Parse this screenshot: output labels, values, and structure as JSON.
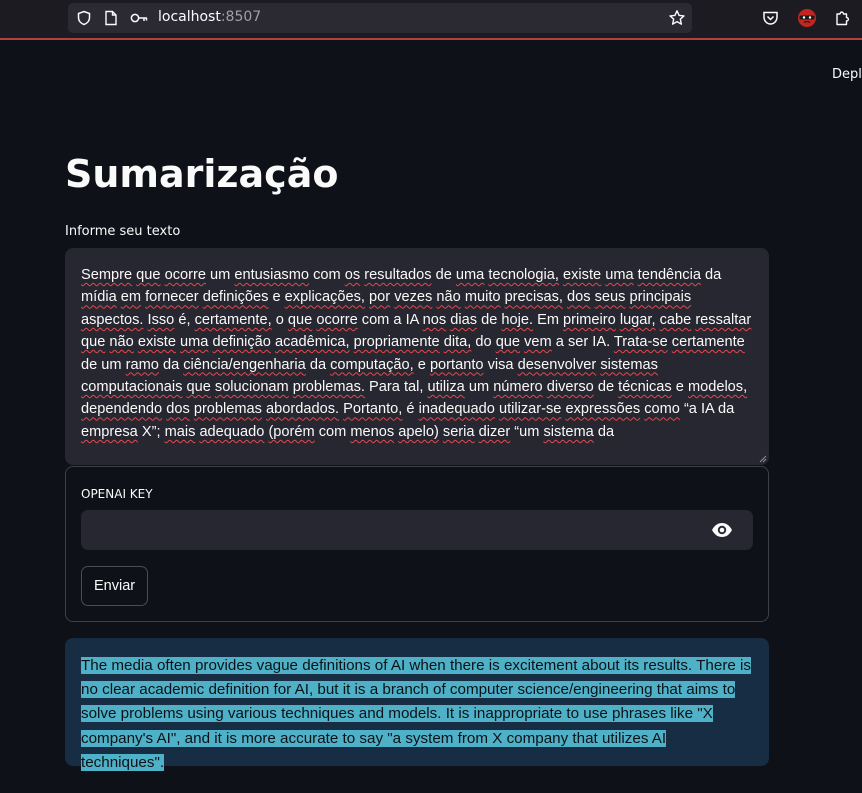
{
  "browser": {
    "url_host": "localhost",
    "url_port": ":8507",
    "icons": [
      "shield-icon",
      "page-icon",
      "key-icon",
      "star-icon",
      "pocket-icon",
      "avatar-icon",
      "extensions-icon"
    ]
  },
  "app": {
    "deploy_label": "Deplo",
    "title": "Sumarização",
    "input_label": "Informe seu texto",
    "input_text": "Sempre que ocorre um entusiasmo com os resultados de uma tecnologia, existe uma tendência da mídia em fornecer definições e explicações, por vezes não muito precisas, dos seus principais aspectos. Isso é, certamente, o que ocorre com a IA nos dias de hoje. Em primeiro lugar, cabe ressaltar que não existe uma definição acadêmica, propriamente dita, do que vem a ser IA. Trata-se certamente de um ramo da ciência/engenharia da computação, e portanto visa desenvolver sistemas computacionais que solucionam problemas. Para tal, utiliza um número diverso de técnicas e modelos, dependendo dos problemas abordados. Portanto, é inadequado utilizar-se expressões como “a IA da empresa X”; mais adequado (porém com menos apelo) seria dizer “um sistema da",
    "key_label": "OPENAI KEY",
    "key_value": "",
    "submit_label": "Enviar",
    "result_text": "The media often provides vague definitions of AI when there is excitement about its results. There is no clear academic definition for AI, but it is a branch of computer science/engineering that aims to solve problems using various techniques and models. It is inappropriate to use phrases like \"X company's AI\", and it is more accurate to say \"a system from X company that utilizes AI techniques\"."
  },
  "colors": {
    "background": "#0e1117",
    "input_bg": "#262730",
    "result_bg": "#172d43",
    "selection": "#4fb1c7",
    "spellcheck": "#e5484d"
  }
}
